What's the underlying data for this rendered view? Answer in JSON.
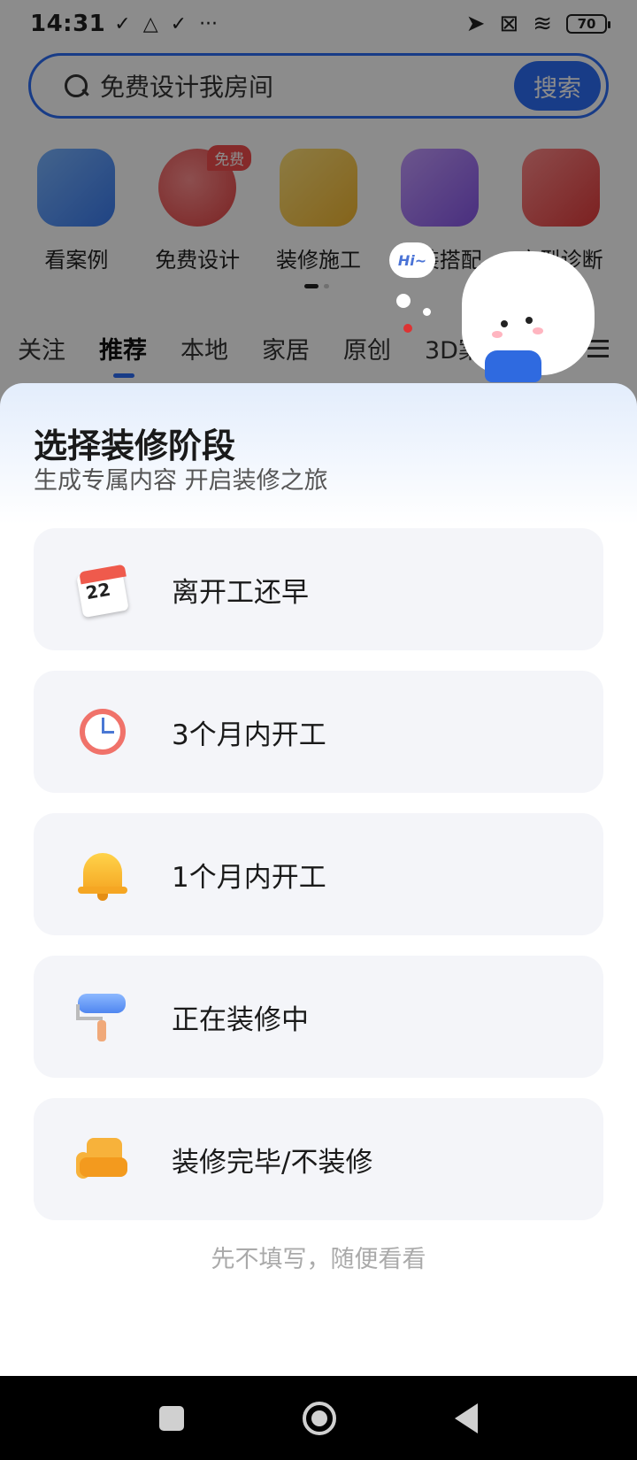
{
  "status_bar": {
    "time": "14:31",
    "battery": "70",
    "left_icons": [
      "check-icon",
      "drive-icon",
      "check-icon",
      "more-dots-icon"
    ],
    "right_icons": [
      "location-arrow-icon",
      "sim-off-icon",
      "wifi-icon",
      "battery-icon"
    ]
  },
  "search": {
    "placeholder": "免费设计我房间",
    "button_label": "搜索",
    "accent_color": "#2d6df6"
  },
  "quick_nav": [
    {
      "label": "看案例",
      "icon": "photo-icon"
    },
    {
      "label": "免费设计",
      "icon": "palette-icon",
      "badge": "免费"
    },
    {
      "label": "装修施工",
      "icon": "paint-roller-icon"
    },
    {
      "label": "软装搭配",
      "icon": "armchair-icon"
    },
    {
      "label": "户型诊断",
      "icon": "medical-kit-icon"
    }
  ],
  "feed_tabs": [
    "关注",
    "推荐",
    "本地",
    "家居",
    "原创",
    "3D案例"
  ],
  "active_feed_tab": "推荐",
  "mascot": {
    "bubble_text": "Hi~"
  },
  "sheet": {
    "title": "选择装修阶段",
    "subtitle": "生成专属内容 开启装修之旅",
    "options": [
      {
        "label": "离开工还早",
        "icon": "calendar-icon",
        "calendar_number": "22"
      },
      {
        "label": "3个月内开工",
        "icon": "clock-icon"
      },
      {
        "label": "1个月内开工",
        "icon": "bell-icon"
      },
      {
        "label": "正在装修中",
        "icon": "paint-roller-icon"
      },
      {
        "label": "装修完毕/不装修",
        "icon": "sofa-icon"
      }
    ],
    "skip_label": "先不填写，随便看看"
  },
  "navbar": {
    "buttons": [
      "recents-button",
      "home-button",
      "back-button"
    ]
  }
}
